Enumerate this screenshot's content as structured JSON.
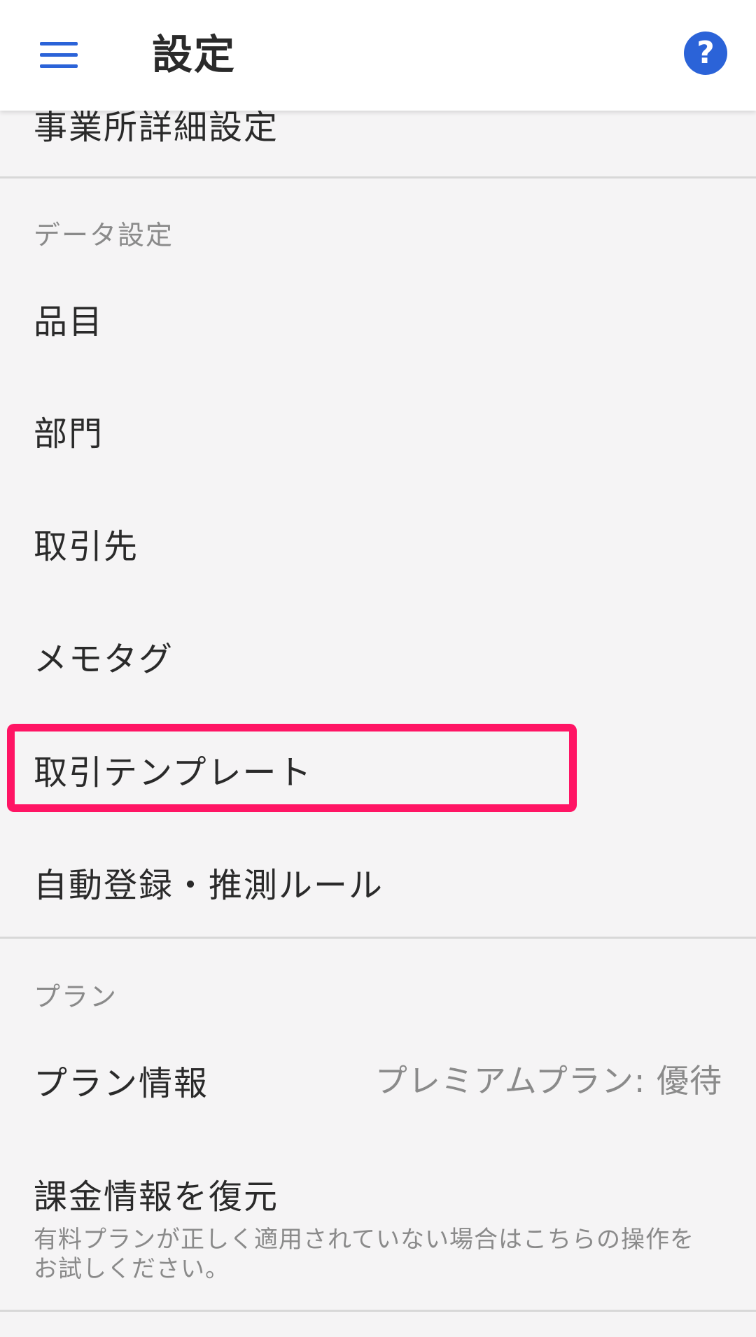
{
  "header": {
    "title": "設定",
    "menu_icon": "hamburger-menu-icon",
    "help_icon": "help-question-icon",
    "help_glyph": "?"
  },
  "colors": {
    "accent": "#2b63d8",
    "highlight": "#ff1464",
    "background": "#f5f4f5",
    "secondary_text": "#8a8a8a"
  },
  "sections": {
    "top_partial_item": "事業所詳細設定",
    "data_settings": {
      "header": "データ設定",
      "items": [
        "品目",
        "部門",
        "取引先",
        "メモタグ",
        "取引テンプレート",
        "自動登録・推測ルール"
      ]
    },
    "plan": {
      "header": "プラン",
      "plan_info": {
        "label": "プラン情報",
        "value": "プレミアムプラン: 優待"
      },
      "restore": {
        "label": "課金情報を復元",
        "description": "有料プランが正しく適用されていない場合はこちらの操作をお試しください。"
      }
    }
  }
}
